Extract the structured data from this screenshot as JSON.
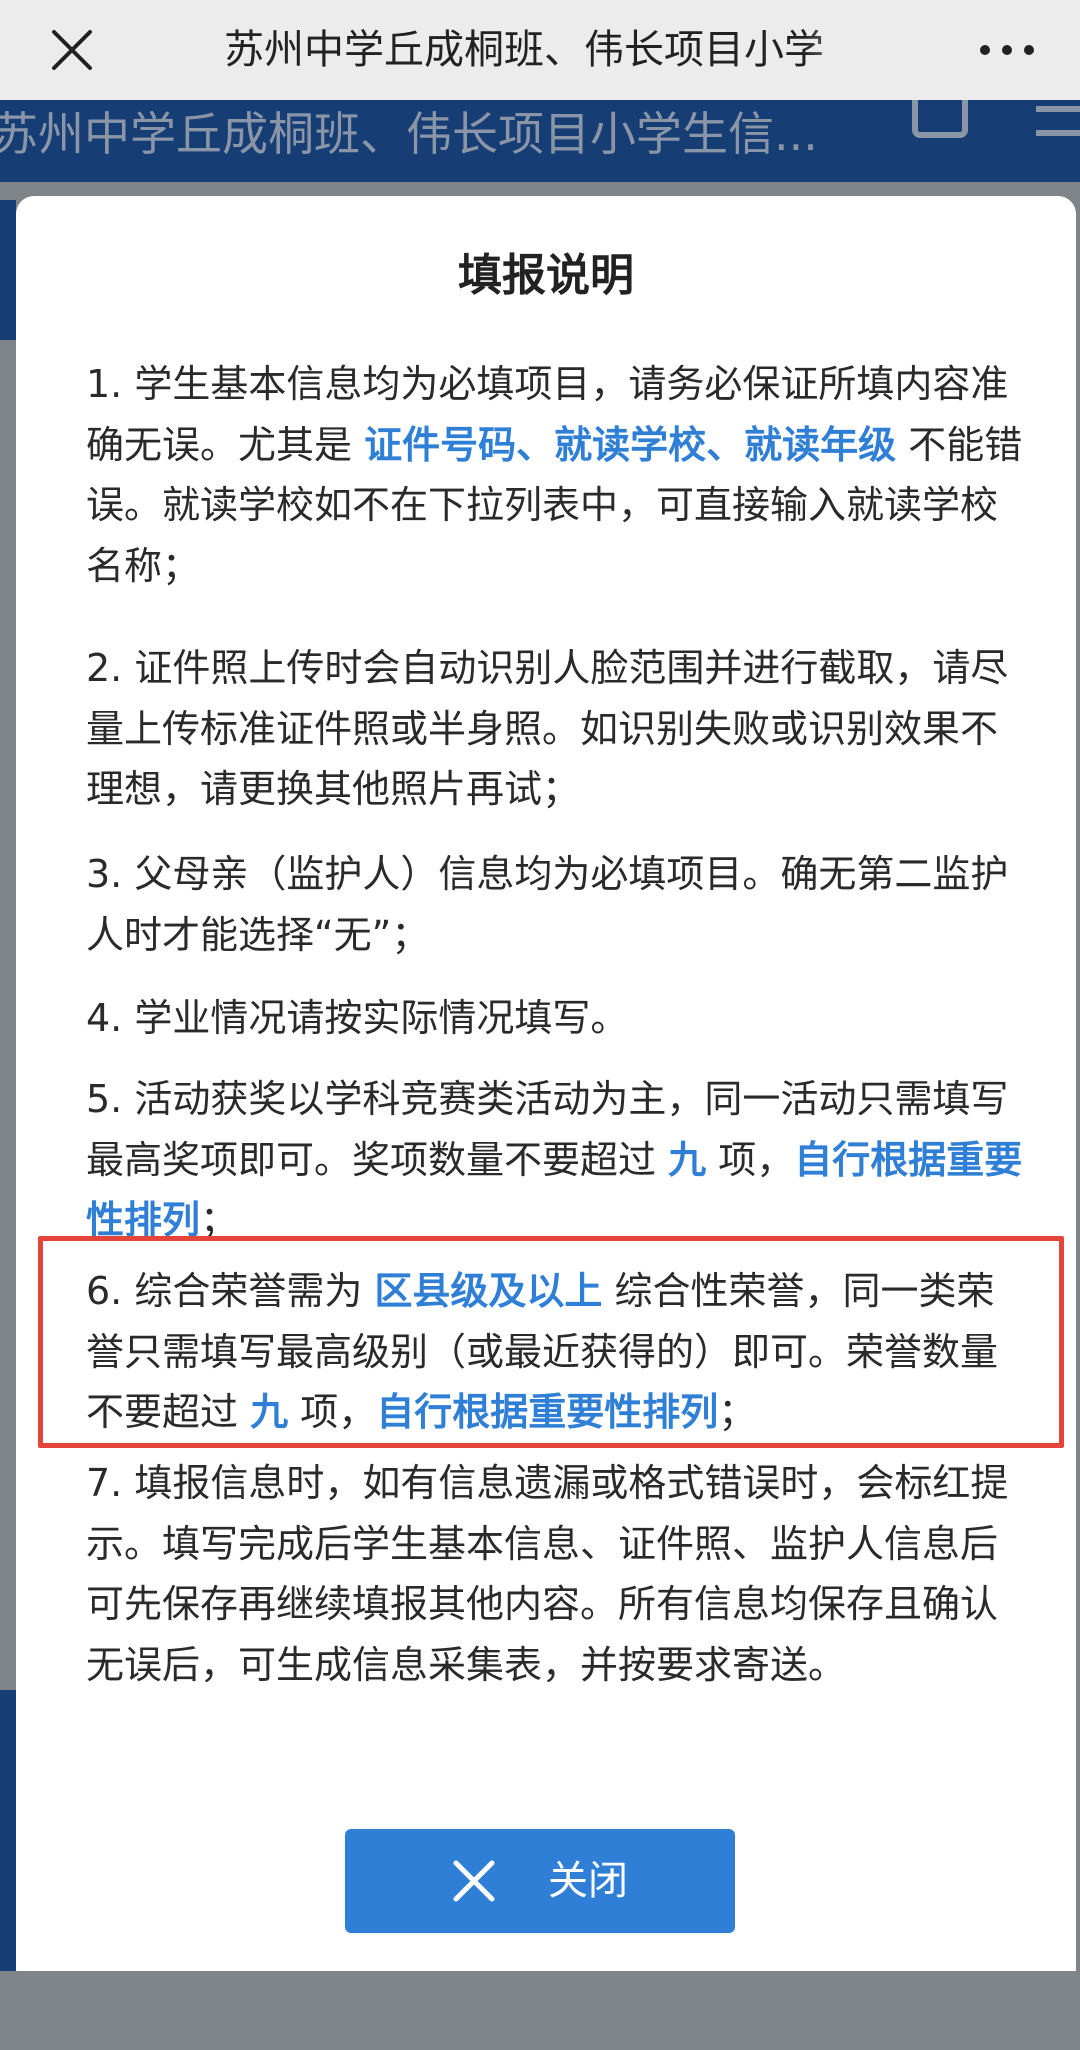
{
  "topbar": {
    "title": "苏州中学丘成桐班、伟长项目小学"
  },
  "page_header": {
    "title": "苏州中学丘成桐班、伟长项目小学生信..."
  },
  "modal": {
    "title": "填报说明",
    "items": [
      {
        "parts": [
          {
            "t": "1. 学生基本信息均为必填项目，请务必保证所填内容准确无误。尤其是 ",
            "h": false
          },
          {
            "t": "证件号码、就读学校、就读年级",
            "h": true
          },
          {
            "t": " 不能错误。就读学校如不在下拉列表中，可直接输入就读学校名称；",
            "h": false
          }
        ]
      },
      {
        "parts": [
          {
            "t": "2. 证件照上传时会自动识别人脸范围并进行截取，请尽量上传标准证件照或半身照。如识别失败或识别效果不理想，请更换其他照片再试；",
            "h": false
          }
        ]
      },
      {
        "parts": [
          {
            "t": "3. 父母亲（监护人）信息均为必填项目。确无第二监护人时才能选择“无”；",
            "h": false
          }
        ]
      },
      {
        "parts": [
          {
            "t": "4. 学业情况请按实际情况填写。",
            "h": false
          }
        ]
      },
      {
        "parts": [
          {
            "t": "5. 活动获奖以学科竞赛类活动为主，同一活动只需填写最高奖项即可。奖项数量不要超过 ",
            "h": false
          },
          {
            "t": "九",
            "h": true
          },
          {
            "t": " 项，",
            "h": false
          },
          {
            "t": "自行根据重要性排列",
            "h": true
          },
          {
            "t": "；",
            "h": false
          }
        ]
      },
      {
        "parts": [
          {
            "t": "6. 综合荣誉需为 ",
            "h": false
          },
          {
            "t": "区县级及以上",
            "h": true
          },
          {
            "t": " 综合性荣誉，同一类荣誉只需填写最高级别（或最近获得的）即可。荣誉数量不要超过 ",
            "h": false
          },
          {
            "t": "九",
            "h": true
          },
          {
            "t": " 项，",
            "h": false
          },
          {
            "t": "自行根据重要性排列",
            "h": true
          },
          {
            "t": "；",
            "h": false
          }
        ]
      },
      {
        "parts": [
          {
            "t": "7. 填报信息时，如有信息遗漏或格式错误时，会标红提示。填写完成后学生基本信息、证件照、监护人信息后可先保存再继续填报其他内容。所有信息均保存且确认无误后，可生成信息采集表，并按要求寄送。",
            "h": false
          }
        ]
      }
    ],
    "close_label": "关闭"
  },
  "colors": {
    "accent": "#2f7fd6",
    "highlight_border": "#e5443b",
    "header_bg": "#173e74"
  },
  "icons": [
    "close-icon",
    "more-icon",
    "share-icon",
    "menu-icon"
  ]
}
